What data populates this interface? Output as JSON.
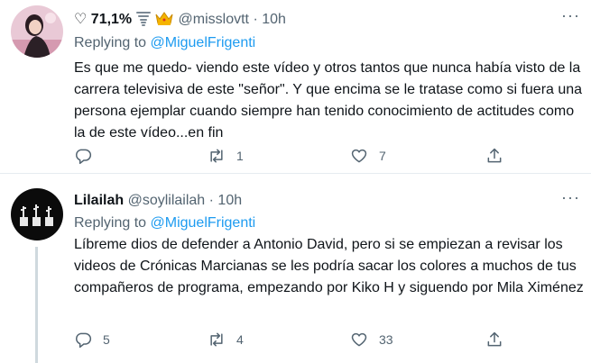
{
  "tweets": [
    {
      "display_name": "♡ 71,1%",
      "handle": "@misslovtt",
      "time": "10h",
      "reply_prefix": "Replying to",
      "reply_to": "@MiguelFrigenti",
      "text": "Es que me quedo- viendo este vídeo y otros tantos que nunca había visto de la carrera televisiva de este \"señor\". Y que encima se le tratase como si fuera una persona ejemplar cuando siempre han tenido conocimiento de actitudes como la de este vídeo...en fin",
      "replies": "",
      "retweets": "1",
      "likes": "7"
    },
    {
      "display_name": "Lilailah",
      "handle": "@soylilailah",
      "time": "10h",
      "reply_prefix": "Replying to",
      "reply_to": "@MiguelFrigenti",
      "text": "Líbreme dios de defender a Antonio David, pero si se empiezan a revisar los videos de Crónicas Marcianas se les podría sacar los colores a muchos de tus compañeros de programa, empezando por Kiko H y siguendo por Mila Ximénez",
      "replies": "5",
      "retweets": "4",
      "likes": "33"
    }
  ],
  "separator": "·",
  "more_glyph": "···",
  "icons": [
    "tornado-icon",
    "crown-icon",
    "reply-icon",
    "retweet-icon",
    "like-icon",
    "share-icon",
    "more-icon"
  ],
  "colors": {
    "link": "#1d9bf0",
    "secondary": "#536471",
    "text": "#0f1419",
    "divider": "#e6ecf0"
  }
}
